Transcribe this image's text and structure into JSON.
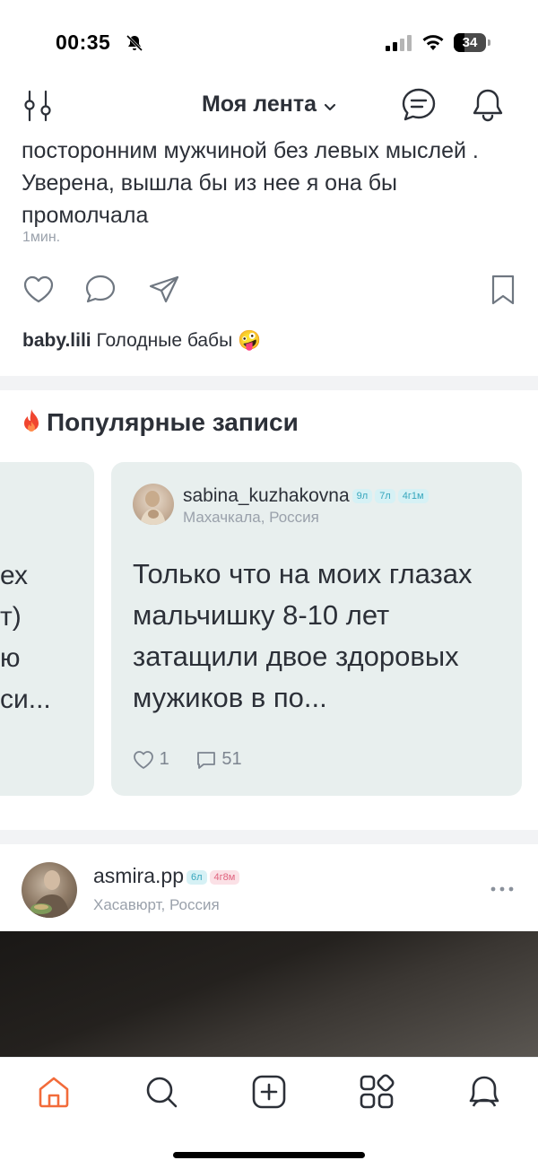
{
  "status_bar": {
    "time": "00:35",
    "battery": "34",
    "battery_level": 0.34,
    "icons": [
      "bell-slash-icon",
      "cellular-signal-icon",
      "wifi-icon",
      "battery-icon"
    ]
  },
  "header": {
    "title": "Моя лента",
    "icons": [
      "filter-sliders-icon",
      "chevron-down-icon",
      "messages-icon",
      "bell-icon"
    ]
  },
  "post_tail": {
    "text": "посторонним мужчиной без левых мыслей . Уверена, вышла бы из нее я она бы промолчала",
    "time": "1мин.",
    "actions": [
      "heart-icon",
      "comment-icon",
      "share-icon",
      "bookmark-icon"
    ],
    "comment": {
      "username": "baby.lili",
      "text": "Голодные бабы",
      "emoji": "🤪"
    }
  },
  "popular": {
    "title": "Популярные записи",
    "icon": "fire-icon",
    "prev_card": {
      "fragments": [
        "ех",
        "т)",
        "ю",
        "си..."
      ]
    },
    "card": {
      "username": "sabina_kuzhakovna",
      "badges": [
        "9л",
        "7л",
        "4г1м"
      ],
      "location": "Махачкала, Россия",
      "text": "Только что на моих глазах мальчишку 8-10 лет затащили  двое здоровых мужиков в по...",
      "likes": "1",
      "comments": "51"
    }
  },
  "next_post": {
    "username": "asmira.pp",
    "badges": [
      "6л",
      "4г8м"
    ],
    "location": "Хасавюрт, Россия"
  },
  "tab_bar": {
    "tabs": [
      "home-icon",
      "search-icon",
      "add-post-icon",
      "services-grid-icon",
      "profile-icon"
    ],
    "active": "home-icon",
    "accent_color": "#f26b3a"
  },
  "colors": {
    "text": "#2c3038",
    "muted": "#9aa1ab",
    "card_bg": "#e8efee",
    "accent": "#f26b3a",
    "badge_blue": "#37a6bd",
    "badge_pink": "#e0647f"
  }
}
